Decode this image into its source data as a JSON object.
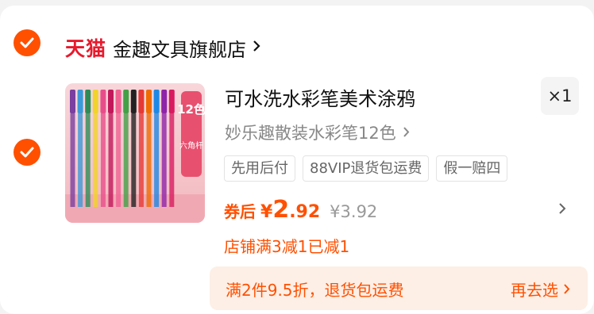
{
  "store": {
    "brand": "天猫",
    "name": "金趣文具旗舰店"
  },
  "product": {
    "title": "可水洗水彩笔美术涂鸦",
    "quantity": "×1",
    "sku": "妙乐趣散装水彩笔12色",
    "tags": [
      "先用后付",
      "88VIP退货包运费",
      "假一赔四"
    ],
    "price_label": "券后",
    "currency": "¥",
    "price_int": "2",
    "price_dec": ".92",
    "original_price": "¥3.92",
    "promo_text": "店铺满3减1已减1",
    "image": {
      "badge_count": "12色",
      "badge_sub": "六角杆",
      "marker_colors": [
        "#7a3fa0",
        "#3b9ad9",
        "#2e8b57",
        "#f1d32a",
        "#e84d8a",
        "#c2185b",
        "#f06292",
        "#43a047",
        "#222222",
        "#e53935",
        "#ef6c00",
        "#1e88e5",
        "#8e24aa",
        "#d81b60"
      ]
    }
  },
  "discount_bar": {
    "text": "满2件9.5折，退货包运费",
    "action": "再去选"
  },
  "colors": {
    "accent": "#ff5000",
    "tmall_red": "#e8192c"
  }
}
